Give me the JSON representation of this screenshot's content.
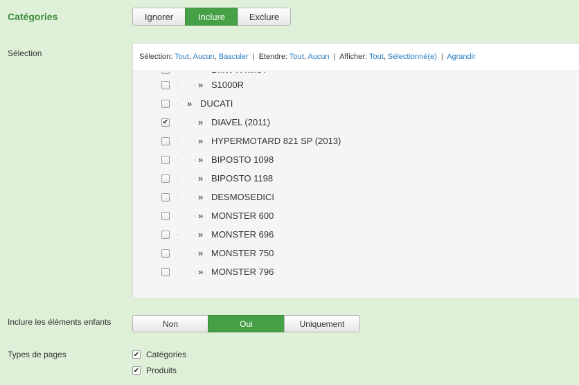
{
  "categories": {
    "title": "Catégories",
    "buttons": [
      "Ignorer",
      "Inclure",
      "Exclure"
    ],
    "active": "Inclure"
  },
  "selection": {
    "label": "Sélection",
    "toolbar": {
      "selection_label": "Sélection:",
      "selection_links": [
        "Tout",
        "Aucun",
        "Basculer"
      ],
      "extend_label": "Etendre:",
      "extend_links": [
        "Tout",
        "Aucun"
      ],
      "show_label": "Afficher:",
      "show_links": [
        "Tout",
        "Sélectionné(e)"
      ],
      "enlarge": "Agrandir"
    },
    "tree": [
      {
        "text": "BMW R nineT",
        "level": 3,
        "checked": false
      },
      {
        "text": "S1000R",
        "level": 3,
        "checked": false
      },
      {
        "text": "DUCATI",
        "level": 2,
        "checked": false
      },
      {
        "text": "DIAVEL (2011)",
        "level": 3,
        "checked": true
      },
      {
        "text": "HYPERMOTARD 821 SP (2013)",
        "level": 3,
        "checked": false
      },
      {
        "text": "BIPOSTO 1098",
        "level": 3,
        "checked": false
      },
      {
        "text": "BIPOSTO 1198",
        "level": 3,
        "checked": false
      },
      {
        "text": "DESMOSEDICI",
        "level": 3,
        "checked": false
      },
      {
        "text": "MONSTER 600",
        "level": 3,
        "checked": false
      },
      {
        "text": "MONSTER 696",
        "level": 3,
        "checked": false
      },
      {
        "text": "MONSTER 750",
        "level": 3,
        "checked": false
      },
      {
        "text": "MONSTER 796",
        "level": 3,
        "checked": false
      }
    ]
  },
  "children": {
    "label": "Inclure les éléments enfants",
    "buttons": [
      "Non",
      "Oui",
      "Uniquement"
    ],
    "active": "Oui"
  },
  "page_types": {
    "label": "Types de pages",
    "options": [
      {
        "label": "Catégories",
        "checked": true
      },
      {
        "label": "Produits",
        "checked": true
      }
    ]
  }
}
